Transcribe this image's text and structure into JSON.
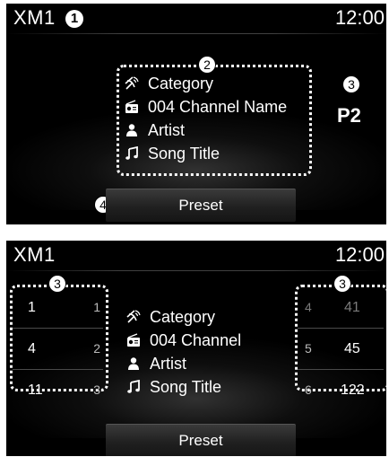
{
  "top_screen": {
    "title": "XM1",
    "time": "12:00",
    "callouts": [
      "1",
      "2",
      "3",
      "4"
    ],
    "info": [
      {
        "icon": "satellite-icon",
        "text": "Category"
      },
      {
        "icon": "radio-icon",
        "text": "004 Channel Name"
      },
      {
        "icon": "person-icon",
        "text": "Artist"
      },
      {
        "icon": "music-note-icon",
        "text": "Song Title"
      }
    ],
    "preset_number": "P2",
    "preset_button": "Preset"
  },
  "bottom_screen": {
    "title": "XM1",
    "time": "12:00",
    "callouts": [
      "3",
      "3"
    ],
    "info": [
      {
        "icon": "satellite-icon",
        "text": "Category"
      },
      {
        "icon": "radio-icon",
        "text": "004 Channel"
      },
      {
        "icon": "person-icon",
        "text": "Artist"
      },
      {
        "icon": "music-note-icon",
        "text": "Song Title"
      }
    ],
    "left_presets": [
      {
        "channel": "1",
        "index": "1"
      },
      {
        "channel": "4",
        "index": "2"
      },
      {
        "channel": "11",
        "index": "3"
      }
    ],
    "right_presets": [
      {
        "index": "4",
        "channel": "41"
      },
      {
        "index": "5",
        "channel": "45"
      },
      {
        "index": "6",
        "channel": "122"
      }
    ],
    "preset_button": "Preset"
  },
  "colors": {
    "screen": "#000000",
    "text": "#ffffff",
    "dim": "#7a7a7a"
  }
}
